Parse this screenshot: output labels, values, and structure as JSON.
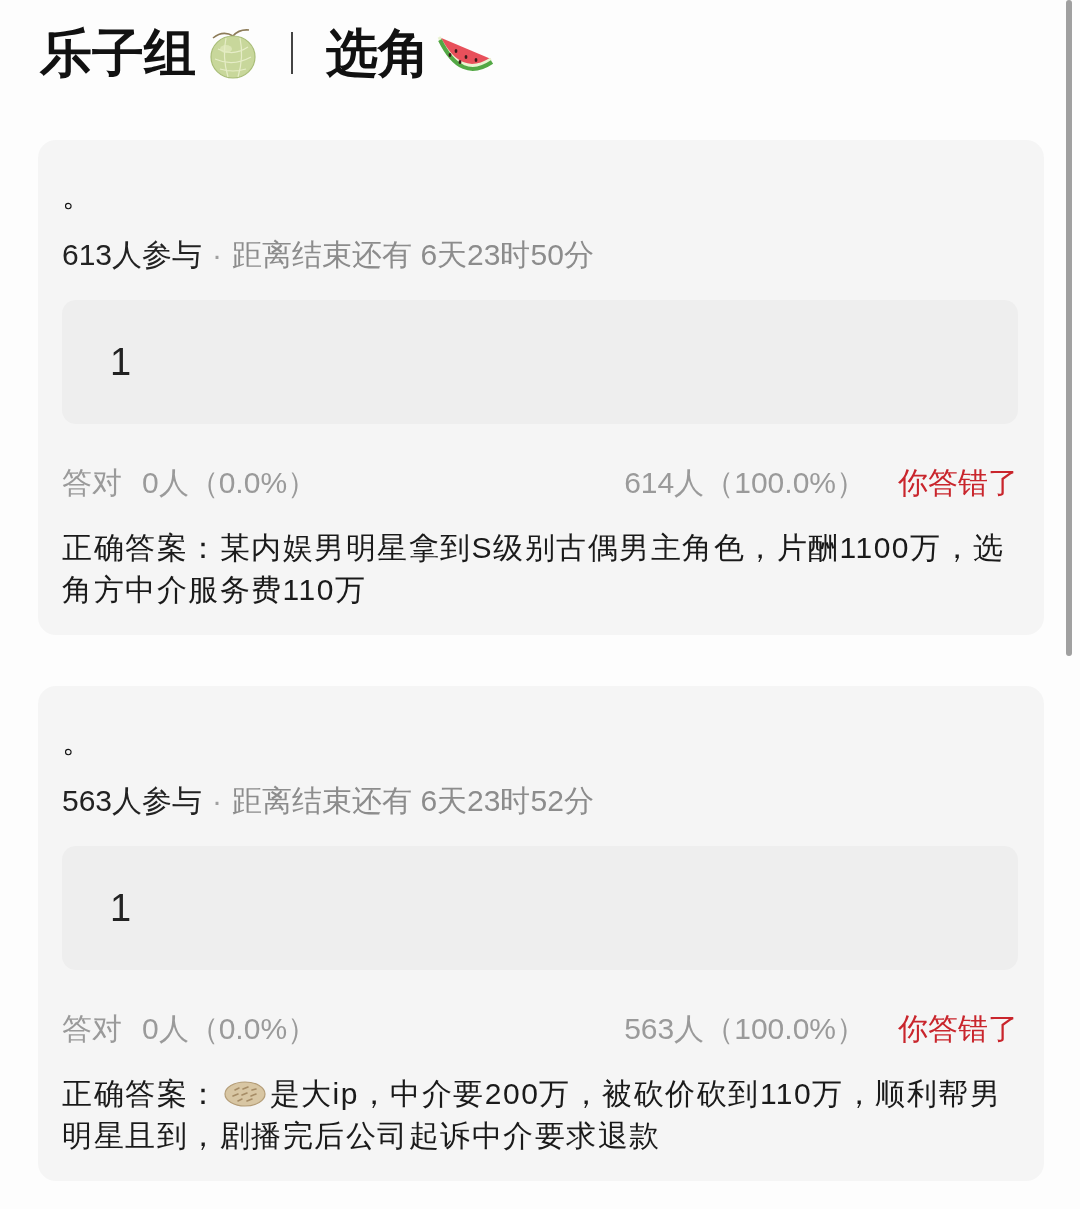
{
  "header": {
    "group": "乐子组",
    "topic": "选角"
  },
  "polls": [
    {
      "question": "。",
      "participants": "613人参与",
      "separator": "·",
      "deadline": "距离结束还有 6天23时50分",
      "option": "1",
      "correct_label": "答对",
      "correct_count": "0人（0.0%）",
      "wrong_count": "614人（100.0%）",
      "result": "你答错了",
      "answer": [
        {
          "kind": "text",
          "text": "正确答案：某内娱男明星拿到S级别古偶男主角色，片酬1100万，选角方中介服务费110万"
        }
      ]
    },
    {
      "question": "。",
      "participants": "563人参与",
      "separator": "·",
      "deadline": "距离结束还有 6天23时52分",
      "option": "1",
      "correct_label": "答对",
      "correct_count": "0人（0.0%）",
      "wrong_count": "563人（100.0%）",
      "result": "你答错了",
      "answer": [
        {
          "kind": "text",
          "text": "正确答案："
        },
        {
          "kind": "icon"
        },
        {
          "kind": "text",
          "text": "是大ip，中介要200万，被砍价砍到110万，顺利帮男"
        },
        {
          "kind": "text",
          "text": "明星且到，剧播完后公司起诉中介要求退款"
        }
      ]
    }
  ]
}
